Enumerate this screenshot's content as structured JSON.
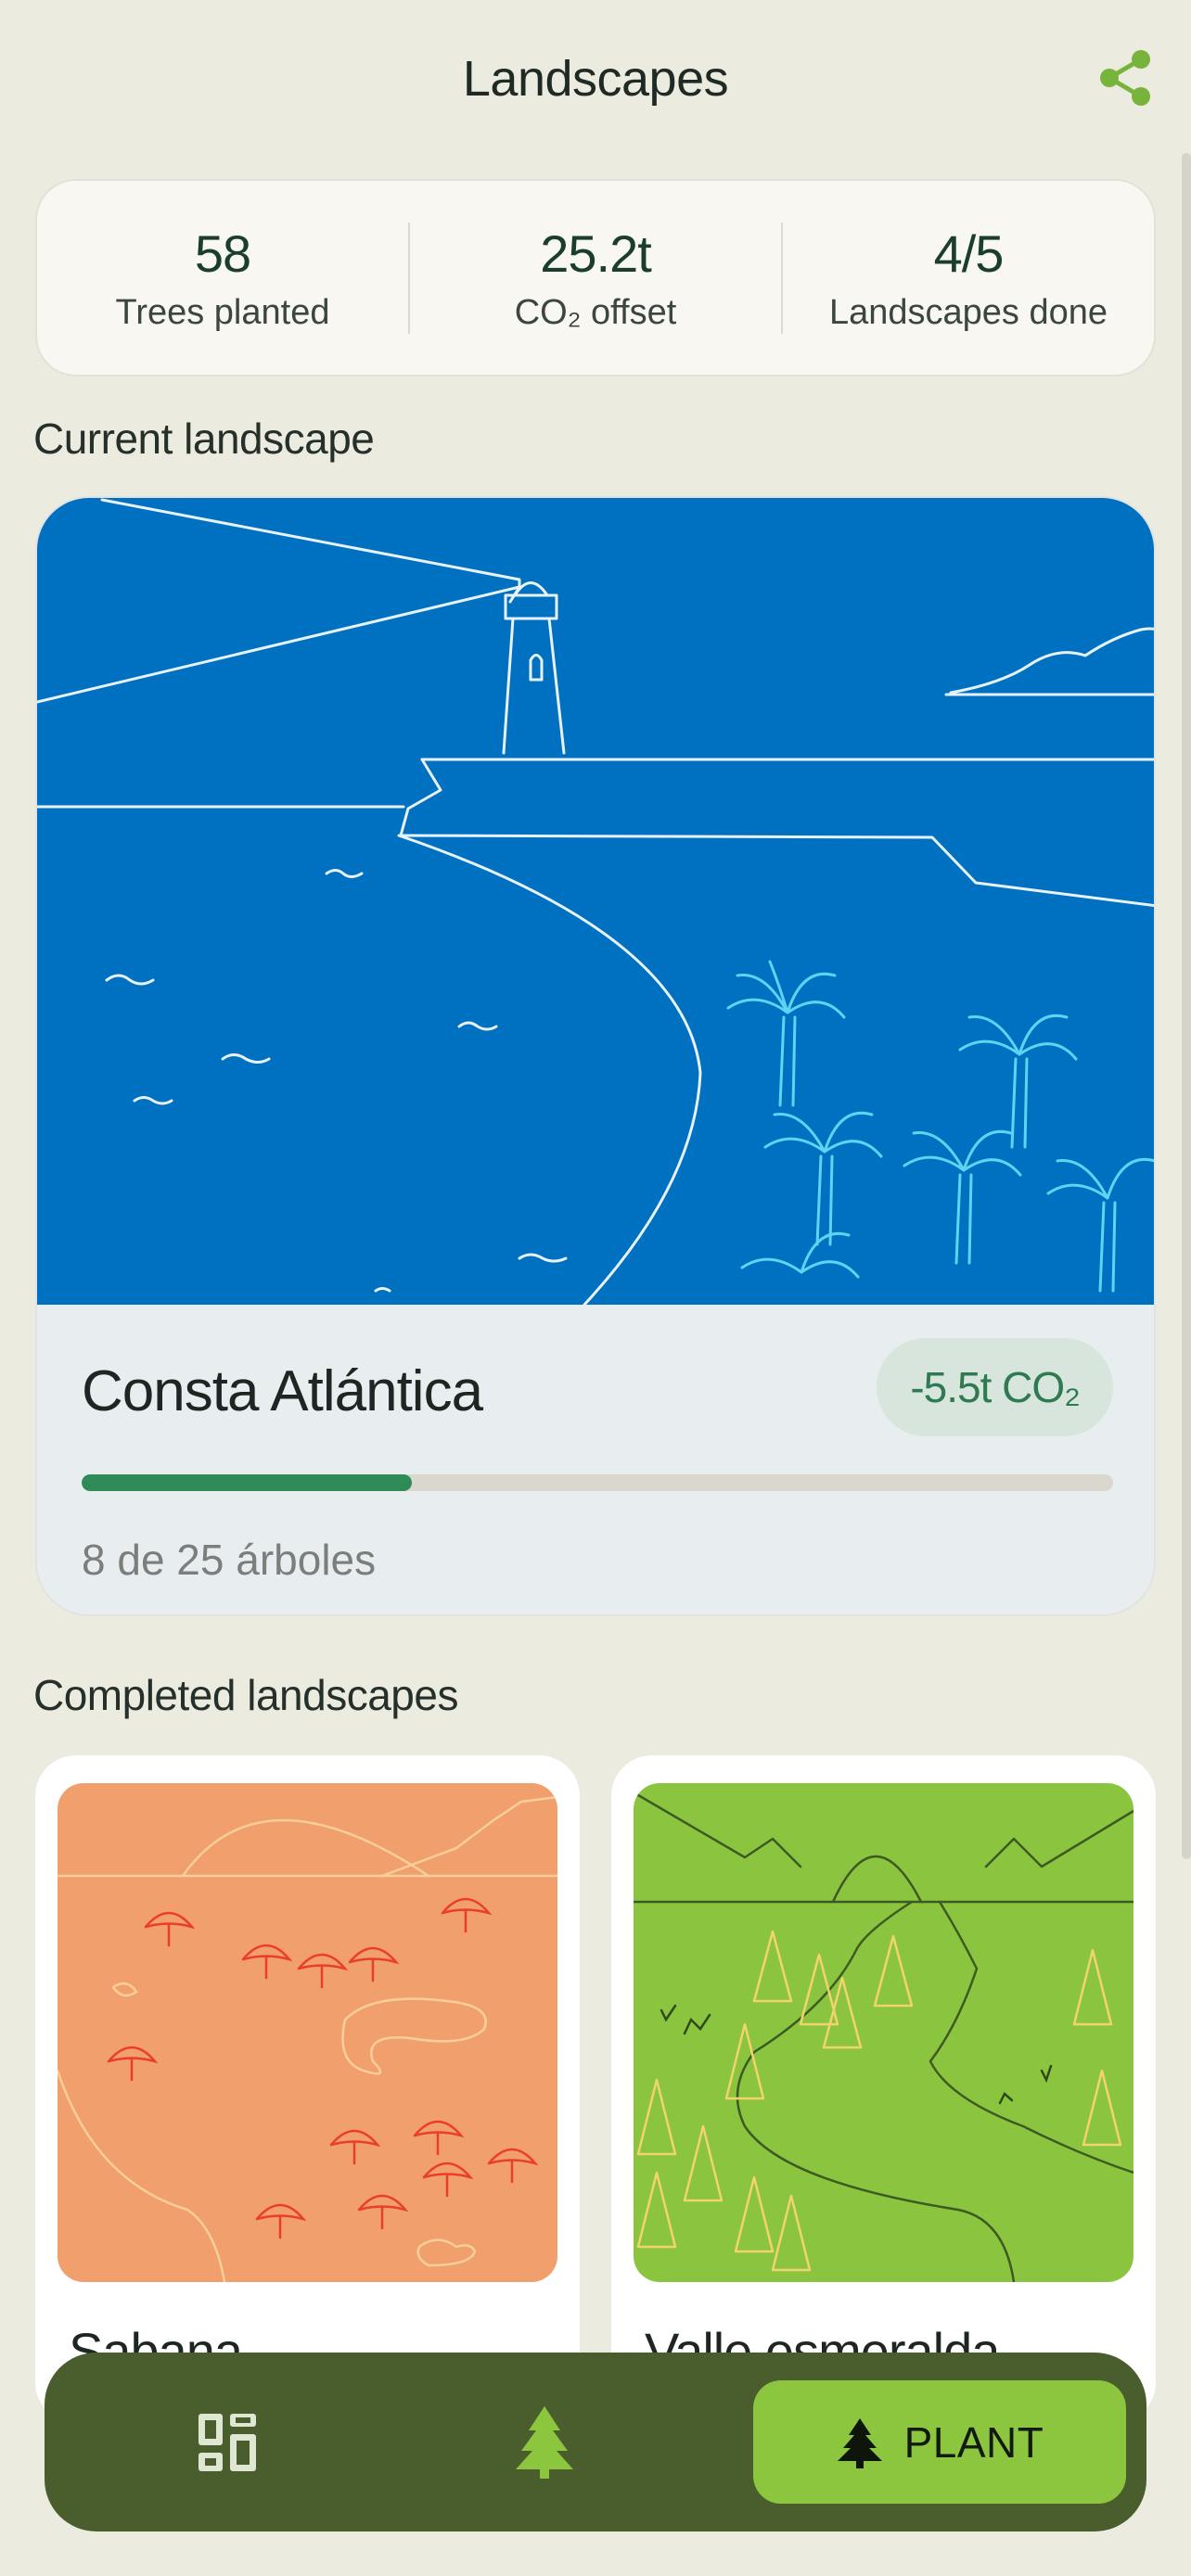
{
  "header": {
    "title": "Landscapes",
    "share_icon": "share-icon"
  },
  "stats": [
    {
      "value": "58",
      "label": "Trees planted"
    },
    {
      "value": "25.2t",
      "label": "CO₂ offset"
    },
    {
      "value": "4/5",
      "label": "Landscapes done"
    }
  ],
  "current": {
    "section_title": "Current landscape",
    "name": "Consta Atlántica",
    "co2": "-5.5t CO₂",
    "progress_text": "8 de 25 árboles",
    "progress_fraction": 0.32,
    "illustration": "lighthouse-coast-palms"
  },
  "completed": {
    "section_title": "Completed landscapes",
    "items": [
      {
        "name": "Sabana",
        "illustration": "savanna-orange"
      },
      {
        "name": "Valle esmeralda",
        "illustration": "emerald-valley-green"
      }
    ]
  },
  "nav": {
    "items": [
      {
        "icon": "grid-icon"
      },
      {
        "icon": "tree-icon"
      }
    ],
    "plant_label": "PLANT",
    "plant_icon": "tree-icon"
  },
  "colors": {
    "background": "#ecebe0",
    "accent_green": "#2e8a57",
    "nav_bg": "#4a5e2d",
    "plant_button": "#8cc63f",
    "ocean_blue": "#0070c1",
    "savanna_orange": "#f29f6e",
    "valley_green": "#8bc53f"
  }
}
